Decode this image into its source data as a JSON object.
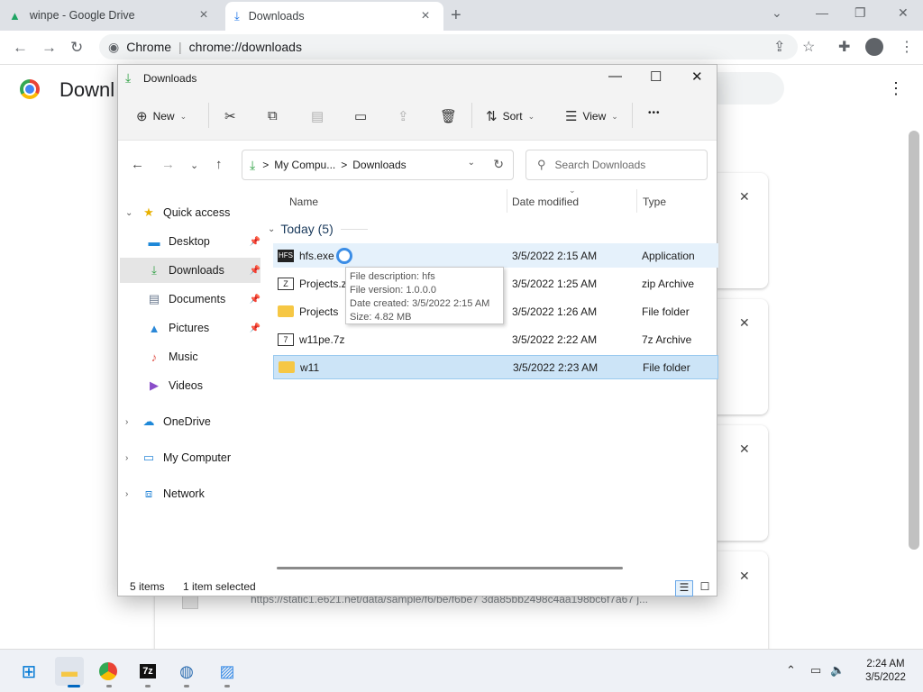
{
  "browser": {
    "tabs": [
      {
        "label": "winpe - Google Drive",
        "icon": "google-drive-icon"
      },
      {
        "label": "Downloads",
        "icon": "download-icon"
      }
    ],
    "omnibox": {
      "site": "Chrome",
      "url": "chrome://downloads"
    }
  },
  "downloads_page": {
    "title": "Downloads",
    "partial_title": "Downl",
    "visible_url": "https://static1.e621.net/data/sample/f6/be/f6be7 3da85bb2498c4aa198bc6f7a67 j..."
  },
  "explorer": {
    "title": "Downloads",
    "commands": {
      "new": "New",
      "sort": "Sort",
      "view": "View",
      "more": "•••"
    },
    "address": {
      "crumb1": "My Compu...",
      "crumb2": "Downloads",
      "sep": ">"
    },
    "search_placeholder": "Search Downloads",
    "nav": {
      "quick_access": "Quick access",
      "desktop": "Desktop",
      "downloads": "Downloads",
      "documents": "Documents",
      "pictures": "Pictures",
      "music": "Music",
      "videos": "Videos",
      "onedrive": "OneDrive",
      "my_computer": "My Computer",
      "network": "Network"
    },
    "columns": {
      "name": "Name",
      "date": "Date modified",
      "type": "Type"
    },
    "group": "Today (5)",
    "files": [
      {
        "name": "hfs.exe",
        "date": "3/5/2022 2:15 AM",
        "type": "Application",
        "icon": "hfs-exe-icon"
      },
      {
        "name": "Projects.zi",
        "date": "3/5/2022 1:25 AM",
        "type": "zip Archive",
        "icon": "archive-icon"
      },
      {
        "name": "Projects",
        "date": "3/5/2022 1:26 AM",
        "type": "File folder",
        "icon": "folder-icon"
      },
      {
        "name": "w11pe.7z",
        "date": "3/5/2022 2:22 AM",
        "type": "7z Archive",
        "icon": "archive-icon"
      },
      {
        "name": "w11",
        "date": "3/5/2022 2:23 AM",
        "type": "File folder",
        "icon": "folder-icon"
      }
    ],
    "tooltip": {
      "description": "File description: hfs",
      "version": "File version: 1.0.0.0",
      "created": "Date created: 3/5/2022 2:15 AM",
      "size": "Size: 4.82 MB"
    },
    "status": {
      "items": "5 items",
      "selected": "1 item selected"
    }
  },
  "taskbar": {
    "time": "2:24 AM",
    "date": "3/5/2022",
    "apps": [
      "start-icon",
      "file-explorer-icon",
      "chrome-icon",
      "7zip-icon",
      "hfs-icon",
      "photos-icon"
    ]
  },
  "colors": {
    "accent": "#0067c0",
    "selection": "#cce4f7",
    "downloads_green": "#2ea043"
  }
}
